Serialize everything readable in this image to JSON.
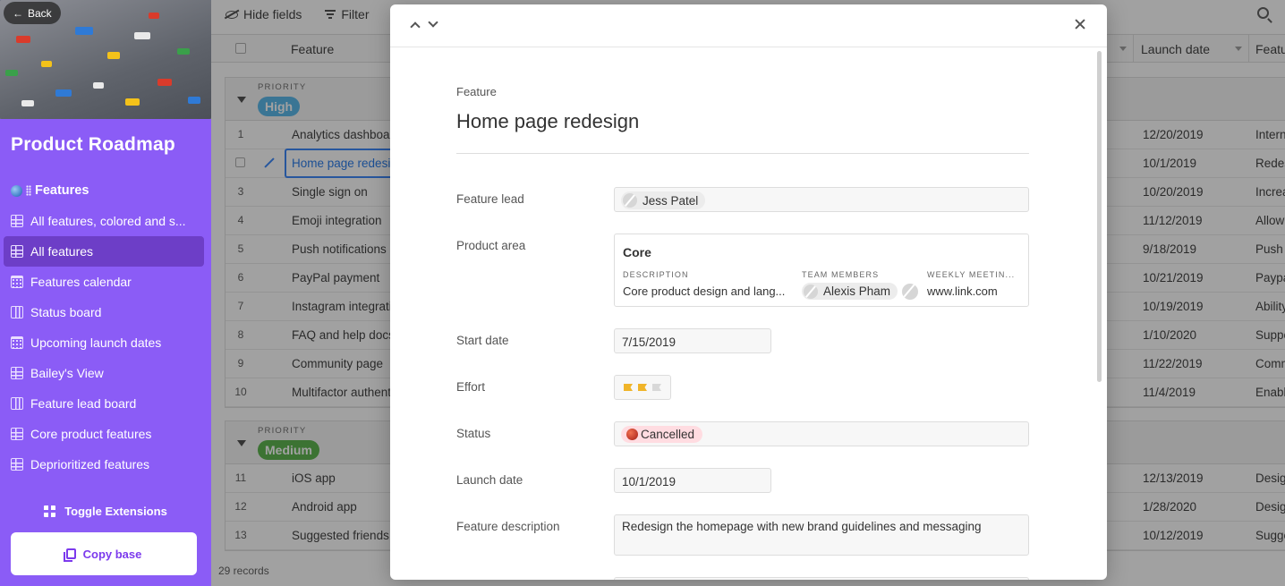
{
  "sidebar": {
    "back_label": "Back",
    "app_title": "Product Roadmap",
    "section_label": "Features",
    "nav_items": [
      {
        "label": "All features, colored and s...",
        "icon": "grid-icon"
      },
      {
        "label": "All features",
        "icon": "grid-icon",
        "active": true
      },
      {
        "label": "Features calendar",
        "icon": "calendar-icon"
      },
      {
        "label": "Status board",
        "icon": "kanban-icon"
      },
      {
        "label": "Upcoming launch dates",
        "icon": "calendar-icon"
      },
      {
        "label": "Bailey's View",
        "icon": "grid-icon"
      },
      {
        "label": "Feature lead board",
        "icon": "kanban-icon"
      },
      {
        "label": "Core product features",
        "icon": "grid-icon"
      },
      {
        "label": "Deprioritized features",
        "icon": "grid-icon"
      }
    ],
    "toggle_extensions": "Toggle Extensions",
    "copy_base": "Copy base",
    "accent": "#8b5cf6"
  },
  "toolbar": {
    "hide_fields": "Hide fields",
    "filter": "Filter"
  },
  "grid": {
    "columns": {
      "feature": "Feature",
      "launch_date": "Launch date",
      "feature_cut": "Featu"
    },
    "groups": [
      {
        "label": "PRIORITY",
        "value": "High",
        "color": "#4fb3e8",
        "rows": [
          {
            "num": "1",
            "feature": "Analytics dashboard",
            "launch": "12/20/2019",
            "desc": "Internal"
          },
          {
            "num": "",
            "feature": "Home page redesign",
            "launch": "10/1/2019",
            "desc": "Redesign",
            "selected": true
          },
          {
            "num": "3",
            "feature": "Single sign on",
            "launch": "10/20/2019",
            "desc": "Increase"
          },
          {
            "num": "4",
            "feature": "Emoji integration",
            "launch": "11/12/2019",
            "desc": "Allow"
          },
          {
            "num": "5",
            "feature": "Push notifications",
            "launch": "9/18/2019",
            "desc": "Push"
          },
          {
            "num": "6",
            "feature": "PayPal payment",
            "launch": "10/21/2019",
            "desc": "Paypal"
          },
          {
            "num": "7",
            "feature": "Instagram integration",
            "launch": "10/19/2019",
            "desc": "Ability"
          },
          {
            "num": "8",
            "feature": "FAQ and help docs",
            "launch": "1/10/2020",
            "desc": "Support"
          },
          {
            "num": "9",
            "feature": "Community page",
            "launch": "11/22/2019",
            "desc": "Community"
          },
          {
            "num": "10",
            "feature": "Multifactor authentication",
            "launch": "11/4/2019",
            "desc": "Enable"
          }
        ]
      },
      {
        "label": "PRIORITY",
        "value": "Medium",
        "color": "#52b043",
        "rows": [
          {
            "num": "11",
            "feature": "iOS app",
            "launch": "12/13/2019",
            "desc": "Design"
          },
          {
            "num": "12",
            "feature": "Android app",
            "launch": "1/28/2020",
            "desc": "Design"
          },
          {
            "num": "13",
            "feature": "Suggested friends",
            "launch": "10/12/2019",
            "desc": "Suggest"
          }
        ]
      }
    ],
    "record_count": "29 records"
  },
  "record": {
    "label": "Feature",
    "title": "Home page redesign",
    "fields": {
      "feature_lead": {
        "label": "Feature lead",
        "value": "Jess Patel"
      },
      "product_area": {
        "label": "Product area",
        "title": "Core",
        "desc_header": "DESCRIPTION",
        "desc_value": "Core product design and lang...",
        "team_header": "TEAM MEMBERS",
        "team_value": "Alexis Pham",
        "meeting_header": "WEEKLY MEETIN...",
        "meeting_value": "www.link.com"
      },
      "start_date": {
        "label": "Start date",
        "value": "7/15/2019"
      },
      "effort": {
        "label": "Effort",
        "rating": 2,
        "max": 3
      },
      "status": {
        "label": "Status",
        "value": "Cancelled",
        "color": "#ffdce1"
      },
      "launch_date": {
        "label": "Launch date",
        "value": "10/1/2019"
      },
      "feature_description": {
        "label": "Feature description",
        "value": "Redesign the homepage with new brand guidelines and messaging"
      }
    }
  }
}
